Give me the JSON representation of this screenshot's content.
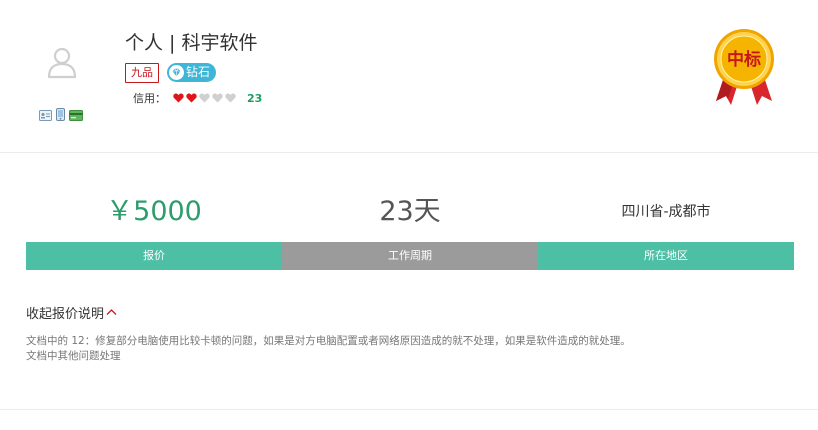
{
  "bidder": {
    "name": "个人 | 科宇软件",
    "level_badge": "九品",
    "diamond_badge": "钻石",
    "credit_label": "信用：",
    "credit_hearts": [
      true,
      true,
      false,
      false,
      false
    ],
    "credit_score": "23",
    "medal_text": "中标",
    "colors": {
      "heart_on": "#e0151c",
      "heart_off": "#d0d0d0",
      "level": "#c8161d",
      "diamond": "#3fb5d8",
      "score": "#1f9b64",
      "medal_gold": "#f5b400",
      "medal_ribbon": "#d9262c"
    },
    "icons": [
      "user-avatar-icon",
      "id-card-icon",
      "phone-icon",
      "bank-card-icon"
    ]
  },
  "stats": {
    "price": {
      "value": "￥5000",
      "label": "报价"
    },
    "period": {
      "value": "23天",
      "label": "工作周期"
    },
    "region": {
      "value": "四川省-成都市",
      "label": "所在地区"
    },
    "colors": {
      "teal": "#4cbfa5",
      "gray": "#9b9b9b",
      "price_text": "#2c9d6b"
    }
  },
  "explanation": {
    "toggle_label": "收起报价说明",
    "lines": [
      "文档中的 12：修复部分电脑使用比较卡顿的问题，如果是对方电脑配置或者网络原因造成的就不处理，如果是软件造成的就处理。",
      "文档中其他问题处理"
    ]
  }
}
